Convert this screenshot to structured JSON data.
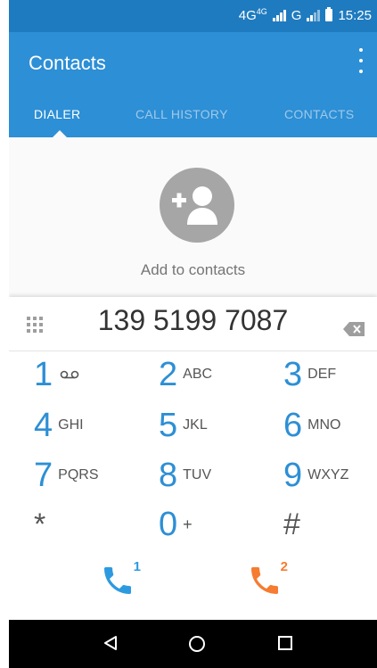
{
  "status_bar": {
    "network": "4G",
    "network_small": "4G",
    "network_2": "G",
    "time": "15:25"
  },
  "app_bar": {
    "title": "Contacts",
    "tabs": [
      {
        "label": "DIALER",
        "active": true
      },
      {
        "label": "CALL HISTORY",
        "active": false
      },
      {
        "label": "CONTACTS",
        "active": false
      }
    ]
  },
  "contact": {
    "add_label": "Add to contacts"
  },
  "dialpad": {
    "number": "139 5199 7087",
    "keys": [
      {
        "digit": "1",
        "letters": ""
      },
      {
        "digit": "2",
        "letters": "ABC"
      },
      {
        "digit": "3",
        "letters": "DEF"
      },
      {
        "digit": "4",
        "letters": "GHI"
      },
      {
        "digit": "5",
        "letters": "JKL"
      },
      {
        "digit": "6",
        "letters": "MNO"
      },
      {
        "digit": "7",
        "letters": "PQRS"
      },
      {
        "digit": "8",
        "letters": "TUV"
      },
      {
        "digit": "9",
        "letters": "WXYZ"
      },
      {
        "digit": "*",
        "letters": ""
      },
      {
        "digit": "0",
        "letters": "+"
      },
      {
        "digit": "#",
        "letters": ""
      }
    ],
    "call_sim1_label": "1",
    "call_sim2_label": "2"
  },
  "colors": {
    "status_bar": "#1f7bbf",
    "app_bar": "#2d8fd5",
    "sim1": "#2d9ae0",
    "sim2": "#f57c30"
  },
  "icons": {
    "menu": "more-vert-icon",
    "avatar": "add-person-icon",
    "dialpad": "dialpad-grid-icon",
    "backspace": "backspace-icon",
    "voicemail": "voicemail-icon",
    "call": "phone-icon",
    "nav_back": "back-triangle-icon",
    "nav_home": "home-circle-icon",
    "nav_recents": "recents-square-icon"
  }
}
